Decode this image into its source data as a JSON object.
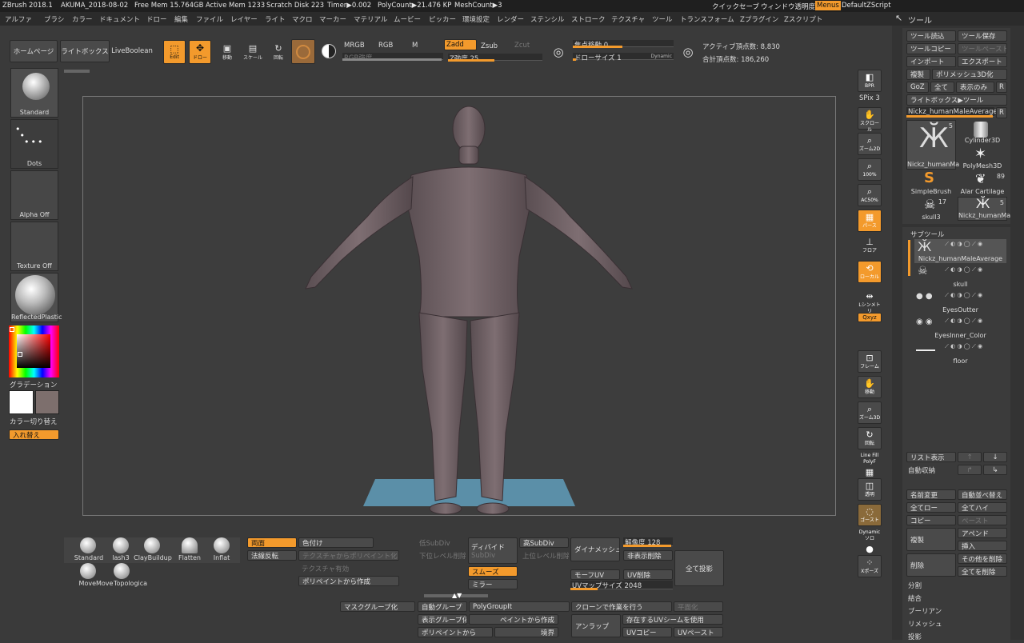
{
  "titlebar": {
    "app": "ZBrush 2018.1",
    "doc": "AKUMA_2018-08-02",
    "free_mem": "Free Mem 15.764GB",
    "active_mem": "Active Mem 1233",
    "scratch": "Scratch Disk 223",
    "timer": "Timer▶0.002",
    "polycount": "PolyCount▶21.476 KP",
    "meshcount": "MeshCount▶3",
    "quicksave": "クイックセーブ",
    "transparency": "ウィンドウ透明度",
    "menus": "Menus",
    "script": "DefaultZScript"
  },
  "menubar": [
    "アルファ",
    "ブラシ",
    "カラー",
    "ドキュメント",
    "ドロー",
    "編集",
    "ファイル",
    "レイヤー",
    "ライト",
    "マクロ",
    "マーカー",
    "マテリアル",
    "ムービー",
    "ピッカー",
    "環境設定",
    "レンダー",
    "ステンシル",
    "ストローク",
    "テクスチャ",
    "ツール",
    "トランスフォーム",
    "Zプラグイン",
    "Zスクリプト"
  ],
  "toolbar": {
    "home": "ホームページ",
    "lightbox": "ライトボックス",
    "liveboolean": "LiveBoolean",
    "edit": "Edit",
    "draw": "ドロー",
    "move": "移動",
    "scale": "スケール",
    "rotate": "回転",
    "mrgb": "MRGB",
    "rgb": "RGB",
    "m": "M",
    "zadd": "Zadd",
    "zsub": "Zsub",
    "zcut": "Zcut",
    "rgb_intensity": "RGB強度",
    "z_intensity": "Z強度 25",
    "focal_shift": "焦点移動 0",
    "draw_size": "ドローサイズ 1",
    "dynamic": "Dynamic",
    "active_points": "アクティブ頂点数: 8,830",
    "total_points": "合計頂点数: 186,260"
  },
  "left": {
    "brush": "Standard",
    "stroke": "Dots",
    "alpha": "Alpha Off",
    "texture": "Texture Off",
    "material": "ReflectedPlastic",
    "gradient": "グラデーション",
    "switch_color": "カラー切り替え",
    "swap": "入れ替え"
  },
  "right_icons": [
    {
      "name": "bpr-icon",
      "label": "BPR"
    },
    {
      "name": "spix-icon",
      "label": "SPix 3"
    },
    {
      "name": "scroll-icon",
      "label": "スクロール"
    },
    {
      "name": "zoom2d-icon",
      "label": "ズーム2D"
    },
    {
      "name": "zoom100-icon",
      "label": "100%"
    },
    {
      "name": "ac50-icon",
      "label": "AC50%"
    },
    {
      "name": "perspective-icon",
      "label": "パース"
    },
    {
      "name": "floor-icon",
      "label": "フロア"
    },
    {
      "name": "local-icon",
      "label": "ローカル"
    },
    {
      "name": "lsym-icon",
      "label": "Lシンメトリ"
    },
    {
      "name": "xyz-icon",
      "label": "Qxyz"
    },
    {
      "name": "frame-icon",
      "label": "フレーム"
    },
    {
      "name": "move-view-icon",
      "label": "移動"
    },
    {
      "name": "zoom3d-icon",
      "label": "ズーム3D"
    },
    {
      "name": "rotate-view-icon",
      "label": "回転"
    },
    {
      "name": "linefill-icon",
      "label": "Line Fill PolyF"
    },
    {
      "name": "transp-icon",
      "label": "透明"
    },
    {
      "name": "ghost-icon",
      "label": "ゴースト"
    },
    {
      "name": "solo-icon",
      "label": "Dynamic ソロ"
    },
    {
      "name": "xpose-icon",
      "label": "Xポーズ"
    }
  ],
  "tool_panel": {
    "title": "ツール",
    "load": "ツール読込",
    "save": "ツール保存",
    "copy": "ツールコピー",
    "paste": "ツールペースト",
    "import": "インポート",
    "export": "エクスポート",
    "clone": "複製",
    "polymesh": "ポリメッシュ3D化",
    "goz": "GoZ",
    "all": "全て",
    "visible": "表示のみ",
    "r": "R",
    "lightbox_tool": "ライトボックス▶ツール",
    "current": "Nickz_humanMaleAverage",
    "tiles": [
      {
        "name": "Nickz_humanMa",
        "count": "5"
      },
      {
        "name": "Cylinder3D",
        "count": ""
      },
      {
        "name": "PolyMesh3D",
        "count": ""
      },
      {
        "name": "SimpleBrush",
        "count": ""
      },
      {
        "name": "Alar Cartilage",
        "count": "89"
      },
      {
        "name": "skull3",
        "count": "17"
      },
      {
        "name": "Nickz_humanMa",
        "count": "5"
      }
    ],
    "subtool_title": "サブツール",
    "subtools": [
      "Nickz_humanMaleAverage",
      "skull",
      "EyesOutter",
      "EyesInner_Color",
      "floor"
    ],
    "list": "リスト表示",
    "autocollapse": "自動収納",
    "rename": "名前変更",
    "autoreorder": "自動並べ替え",
    "all_low": "全てロー",
    "all_high": "全てハイ",
    "copy_st": "コピー",
    "paste_st": "ペースト",
    "duplicate": "複製",
    "append": "アペンド",
    "insert": "挿入",
    "delete": "削除",
    "delete_other": "その他を削除",
    "delete_all": "全てを削除",
    "split": "分割",
    "merge": "結合",
    "boolean": "ブーリアン",
    "remesh": "リメッシュ",
    "project": "投影"
  },
  "bottom": {
    "brushes": [
      "Standard",
      "ClayBuildup",
      "Flatten",
      "Inflat",
      "MoveMove",
      "Topologica"
    ],
    "dam": "lash3",
    "double": "両面",
    "flip": "法線反転",
    "colorize": "色付け",
    "tex_to_poly": "テクスチャからポリペイント化",
    "tex_on": "テクスチャ有効",
    "poly_from": "ポリペイントから作成",
    "lower": "低SubDiv",
    "del_lower": "下位レベル削除",
    "divide": "ディバイド",
    "subdiv": "SubDiv",
    "higher": "高SubDiv",
    "del_higher": "上位レベル削除",
    "smooth": "スムーズ",
    "mirror": "ミラー",
    "dynamesh": "ダイナメッシュ",
    "resolution": "解像度 128",
    "del_hidden": "非表示削除",
    "project_all": "全て投影",
    "morph_uv": "モーフUV",
    "uv_del": "UV削除",
    "uv_map": "UVマップサイズ 2048",
    "mask_group": "マスクグループ化",
    "auto_group": "自動グループ",
    "polygroupit": "PolyGroupIt",
    "clone_op": "クローンで作業を行う",
    "flatten_op": "平面化",
    "vis_group": "表示グループ化",
    "from_paint": "ペイントから作成",
    "unwrap": "アンラップ",
    "use_seam": "存在するUVシームを使用",
    "from_polypaint": "ポリペイントから",
    "border": "境界",
    "uv_copy": "UVコピー",
    "uv_paste": "UVペースト"
  }
}
